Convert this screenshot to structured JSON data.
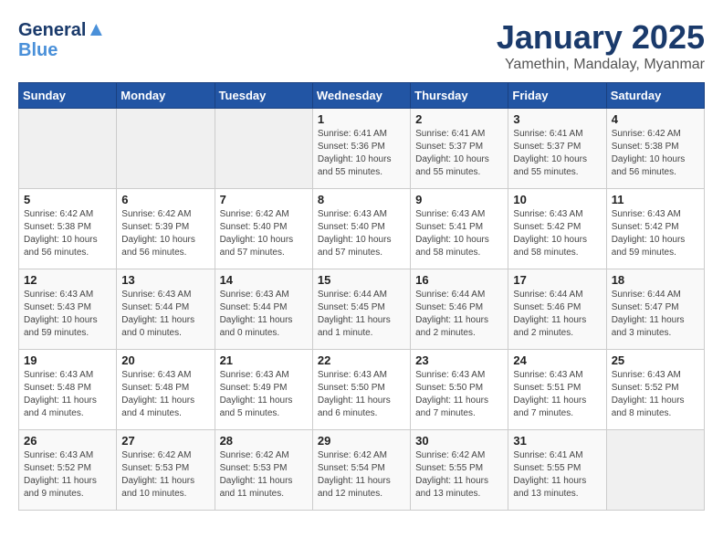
{
  "header": {
    "logo_line1": "General",
    "logo_line2": "Blue",
    "title": "January 2025",
    "subtitle": "Yamethin, Mandalay, Myanmar"
  },
  "days_of_week": [
    "Sunday",
    "Monday",
    "Tuesday",
    "Wednesday",
    "Thursday",
    "Friday",
    "Saturday"
  ],
  "weeks": [
    [
      {
        "day": "",
        "info": ""
      },
      {
        "day": "",
        "info": ""
      },
      {
        "day": "",
        "info": ""
      },
      {
        "day": "1",
        "info": "Sunrise: 6:41 AM\nSunset: 5:36 PM\nDaylight: 10 hours\nand 55 minutes."
      },
      {
        "day": "2",
        "info": "Sunrise: 6:41 AM\nSunset: 5:37 PM\nDaylight: 10 hours\nand 55 minutes."
      },
      {
        "day": "3",
        "info": "Sunrise: 6:41 AM\nSunset: 5:37 PM\nDaylight: 10 hours\nand 55 minutes."
      },
      {
        "day": "4",
        "info": "Sunrise: 6:42 AM\nSunset: 5:38 PM\nDaylight: 10 hours\nand 56 minutes."
      }
    ],
    [
      {
        "day": "5",
        "info": "Sunrise: 6:42 AM\nSunset: 5:38 PM\nDaylight: 10 hours\nand 56 minutes."
      },
      {
        "day": "6",
        "info": "Sunrise: 6:42 AM\nSunset: 5:39 PM\nDaylight: 10 hours\nand 56 minutes."
      },
      {
        "day": "7",
        "info": "Sunrise: 6:42 AM\nSunset: 5:40 PM\nDaylight: 10 hours\nand 57 minutes."
      },
      {
        "day": "8",
        "info": "Sunrise: 6:43 AM\nSunset: 5:40 PM\nDaylight: 10 hours\nand 57 minutes."
      },
      {
        "day": "9",
        "info": "Sunrise: 6:43 AM\nSunset: 5:41 PM\nDaylight: 10 hours\nand 58 minutes."
      },
      {
        "day": "10",
        "info": "Sunrise: 6:43 AM\nSunset: 5:42 PM\nDaylight: 10 hours\nand 58 minutes."
      },
      {
        "day": "11",
        "info": "Sunrise: 6:43 AM\nSunset: 5:42 PM\nDaylight: 10 hours\nand 59 minutes."
      }
    ],
    [
      {
        "day": "12",
        "info": "Sunrise: 6:43 AM\nSunset: 5:43 PM\nDaylight: 10 hours\nand 59 minutes."
      },
      {
        "day": "13",
        "info": "Sunrise: 6:43 AM\nSunset: 5:44 PM\nDaylight: 11 hours\nand 0 minutes."
      },
      {
        "day": "14",
        "info": "Sunrise: 6:43 AM\nSunset: 5:44 PM\nDaylight: 11 hours\nand 0 minutes."
      },
      {
        "day": "15",
        "info": "Sunrise: 6:44 AM\nSunset: 5:45 PM\nDaylight: 11 hours\nand 1 minute."
      },
      {
        "day": "16",
        "info": "Sunrise: 6:44 AM\nSunset: 5:46 PM\nDaylight: 11 hours\nand 2 minutes."
      },
      {
        "day": "17",
        "info": "Sunrise: 6:44 AM\nSunset: 5:46 PM\nDaylight: 11 hours\nand 2 minutes."
      },
      {
        "day": "18",
        "info": "Sunrise: 6:44 AM\nSunset: 5:47 PM\nDaylight: 11 hours\nand 3 minutes."
      }
    ],
    [
      {
        "day": "19",
        "info": "Sunrise: 6:43 AM\nSunset: 5:48 PM\nDaylight: 11 hours\nand 4 minutes."
      },
      {
        "day": "20",
        "info": "Sunrise: 6:43 AM\nSunset: 5:48 PM\nDaylight: 11 hours\nand 4 minutes."
      },
      {
        "day": "21",
        "info": "Sunrise: 6:43 AM\nSunset: 5:49 PM\nDaylight: 11 hours\nand 5 minutes."
      },
      {
        "day": "22",
        "info": "Sunrise: 6:43 AM\nSunset: 5:50 PM\nDaylight: 11 hours\nand 6 minutes."
      },
      {
        "day": "23",
        "info": "Sunrise: 6:43 AM\nSunset: 5:50 PM\nDaylight: 11 hours\nand 7 minutes."
      },
      {
        "day": "24",
        "info": "Sunrise: 6:43 AM\nSunset: 5:51 PM\nDaylight: 11 hours\nand 7 minutes."
      },
      {
        "day": "25",
        "info": "Sunrise: 6:43 AM\nSunset: 5:52 PM\nDaylight: 11 hours\nand 8 minutes."
      }
    ],
    [
      {
        "day": "26",
        "info": "Sunrise: 6:43 AM\nSunset: 5:52 PM\nDaylight: 11 hours\nand 9 minutes."
      },
      {
        "day": "27",
        "info": "Sunrise: 6:42 AM\nSunset: 5:53 PM\nDaylight: 11 hours\nand 10 minutes."
      },
      {
        "day": "28",
        "info": "Sunrise: 6:42 AM\nSunset: 5:53 PM\nDaylight: 11 hours\nand 11 minutes."
      },
      {
        "day": "29",
        "info": "Sunrise: 6:42 AM\nSunset: 5:54 PM\nDaylight: 11 hours\nand 12 minutes."
      },
      {
        "day": "30",
        "info": "Sunrise: 6:42 AM\nSunset: 5:55 PM\nDaylight: 11 hours\nand 13 minutes."
      },
      {
        "day": "31",
        "info": "Sunrise: 6:41 AM\nSunset: 5:55 PM\nDaylight: 11 hours\nand 13 minutes."
      },
      {
        "day": "",
        "info": ""
      }
    ]
  ]
}
